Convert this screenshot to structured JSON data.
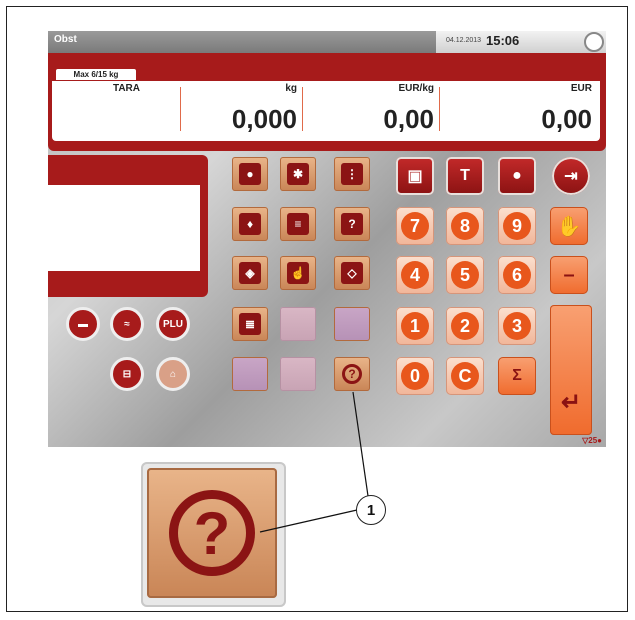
{
  "header": {
    "app_title": "Obst",
    "date": "04.12.2013",
    "time": "15:06"
  },
  "display": {
    "max_label": "Max 6/15 kg",
    "tara_label": "TARA",
    "weight_unit": "kg",
    "weight_value": "0,000",
    "price_unit": "EUR/kg",
    "price_value": "0,00",
    "total_unit": "EUR",
    "total_value": "0,00"
  },
  "left_buttons": {
    "plu_label": "PLU"
  },
  "keypad": {
    "keys": [
      "7",
      "8",
      "9",
      "4",
      "5",
      "6",
      "1",
      "2",
      "3",
      "0",
      "C",
      "Σ"
    ],
    "minus": "–",
    "enter": "↵"
  },
  "icons": {
    "help": "?"
  },
  "status": {
    "counter": "25"
  },
  "callout": {
    "label": "1"
  },
  "colors": {
    "brand_red": "#a71b1b",
    "accent_orange": "#f06b2d",
    "tile_tan": "#d9955f"
  }
}
